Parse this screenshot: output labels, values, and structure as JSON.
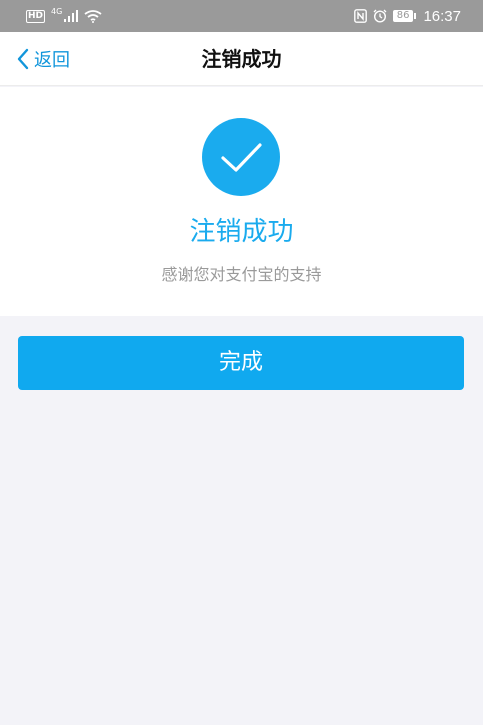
{
  "status_bar": {
    "hd": "HD",
    "network": "4G",
    "battery": "86",
    "time": "16:37"
  },
  "nav": {
    "back_label": "返回",
    "title": "注销成功"
  },
  "result": {
    "icon": "check-icon",
    "title": "注销成功",
    "subtitle": "感谢您对支付宝的支持"
  },
  "actions": {
    "done_label": "完成"
  },
  "colors": {
    "accent": "#1aabee",
    "button": "#10a9ef",
    "background": "#f3f3f8"
  }
}
